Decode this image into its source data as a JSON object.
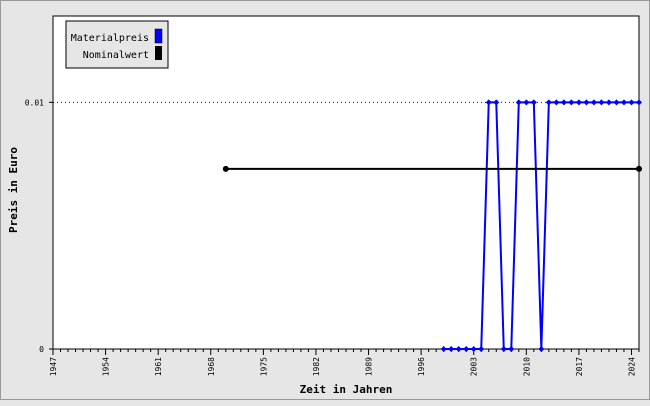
{
  "chart_data": {
    "type": "line",
    "xlabel": "Zeit in Jahren",
    "ylabel": "Preis in Euro",
    "xlim": [
      1947,
      2025
    ],
    "ylim": [
      0,
      0.0135
    ],
    "x_ticks": [
      1947,
      1954,
      1961,
      1968,
      1975,
      1982,
      1989,
      1996,
      2003,
      2010,
      2017,
      2024
    ],
    "y_ticks": [
      {
        "value": 0,
        "label": "0"
      },
      {
        "value": 0.01,
        "label": "0.01"
      }
    ],
    "reference_line": {
      "value": 0.01,
      "style": "dotted",
      "color": "#0000cc"
    },
    "legend": {
      "position": "top-left"
    },
    "series": [
      {
        "name": "Materialpreis",
        "color": "#0000ff",
        "marker": "diamond",
        "points": [
          [
            1999,
            0
          ],
          [
            2000,
            0
          ],
          [
            2001,
            0
          ],
          [
            2002,
            0
          ],
          [
            2003,
            0
          ],
          [
            2004,
            0
          ],
          [
            2005,
            0.01
          ],
          [
            2006,
            0.01
          ],
          [
            2007,
            0
          ],
          [
            2008,
            0
          ],
          [
            2009,
            0.01
          ],
          [
            2010,
            0.01
          ],
          [
            2011,
            0.01
          ],
          [
            2012,
            0
          ],
          [
            2013,
            0.01
          ],
          [
            2014,
            0.01
          ],
          [
            2015,
            0.01
          ],
          [
            2016,
            0.01
          ],
          [
            2017,
            0.01
          ],
          [
            2018,
            0.01
          ],
          [
            2019,
            0.01
          ],
          [
            2020,
            0.01
          ],
          [
            2021,
            0.01
          ],
          [
            2022,
            0.01
          ],
          [
            2023,
            0.01
          ],
          [
            2024,
            0.01
          ],
          [
            2025,
            0.01
          ]
        ]
      },
      {
        "name": "Nominalwert",
        "color": "#000000",
        "marker": "circle",
        "points": [
          [
            1970,
            0.0073
          ],
          [
            2025,
            0.0073
          ]
        ]
      }
    ]
  }
}
